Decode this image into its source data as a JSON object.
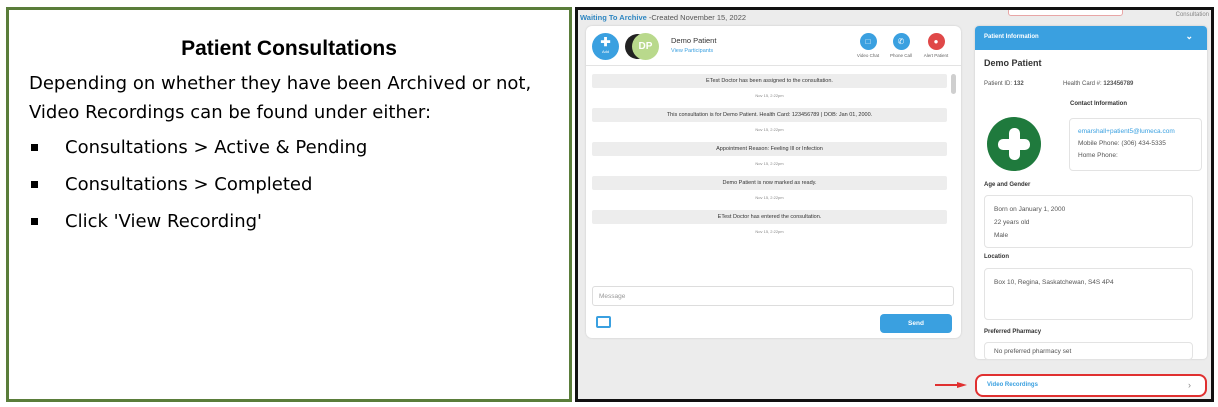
{
  "instructions": {
    "title": "Patient Consultations",
    "body": "Depending on whether they have been Archived or not, Video Recordings can be found under either:",
    "bullets": [
      "Consultations > Active & Pending",
      "Consultations > Completed",
      "Click 'View Recording'"
    ]
  },
  "screenshot": {
    "status_title": "Waiting To Archive",
    "status_created": " -Created November 15, 2022",
    "top_right_label": "Consultation",
    "chat": {
      "add_label": "Add",
      "avatar_initials": "DP",
      "patient_name": "Demo Patient",
      "view_participants": "View Participants",
      "actions": [
        {
          "label": "Video Chat",
          "color": "#3aa0e0",
          "icon": "video-camera-icon"
        },
        {
          "label": "Phone Call",
          "color": "#3aa0e0",
          "icon": "phone-icon"
        },
        {
          "label": "Alert Patient",
          "color": "#e04848",
          "icon": "bell-icon"
        }
      ],
      "messages": [
        {
          "text": "ETest Doctor has been assigned to the consultation.",
          "time": "Nov 15, 2:22pm"
        },
        {
          "text": "This consultation is for Demo Patient. Health Card: 123456789 | DOB: Jan 01, 2000.",
          "time": "Nov 15, 2:22pm"
        },
        {
          "text": "Appointment Reason: Feeling Ill or Infection",
          "time": "Nov 15, 2:22pm"
        },
        {
          "text": "Demo Patient is now marked as ready.",
          "time": "Nov 15, 2:22pm"
        },
        {
          "text": "ETest Doctor has entered the consultation.",
          "time": "Nov 15, 2:22pm"
        }
      ],
      "message_placeholder": "Message",
      "send_label": "Send"
    },
    "info": {
      "header": "Patient Information",
      "name": "Demo Patient",
      "patient_id_label": "Patient ID: ",
      "patient_id": "132",
      "health_card_label": "Health Card #: ",
      "health_card": "123456789",
      "contact_title": "Contact Information",
      "email": "emarshall+patient5@lumeca.com",
      "mobile": "Mobile Phone: (306) 434-5335",
      "home": "Home Phone:",
      "age_title": "Age and Gender",
      "born": "Born on January 1, 2000",
      "age": "22 years old",
      "gender": "Male",
      "location_title": "Location",
      "location": "Box 10, Regina, Saskatchewan, S4S 4P4",
      "pharmacy_title": "Preferred Pharmacy",
      "pharmacy": "No preferred pharmacy set"
    },
    "video_recordings": "Video Recordings",
    "colors": {
      "accent": "#3aa0e0",
      "highlight": "#e03030",
      "logo": "#1f7a3d",
      "frame": "#5a7d3a"
    }
  }
}
